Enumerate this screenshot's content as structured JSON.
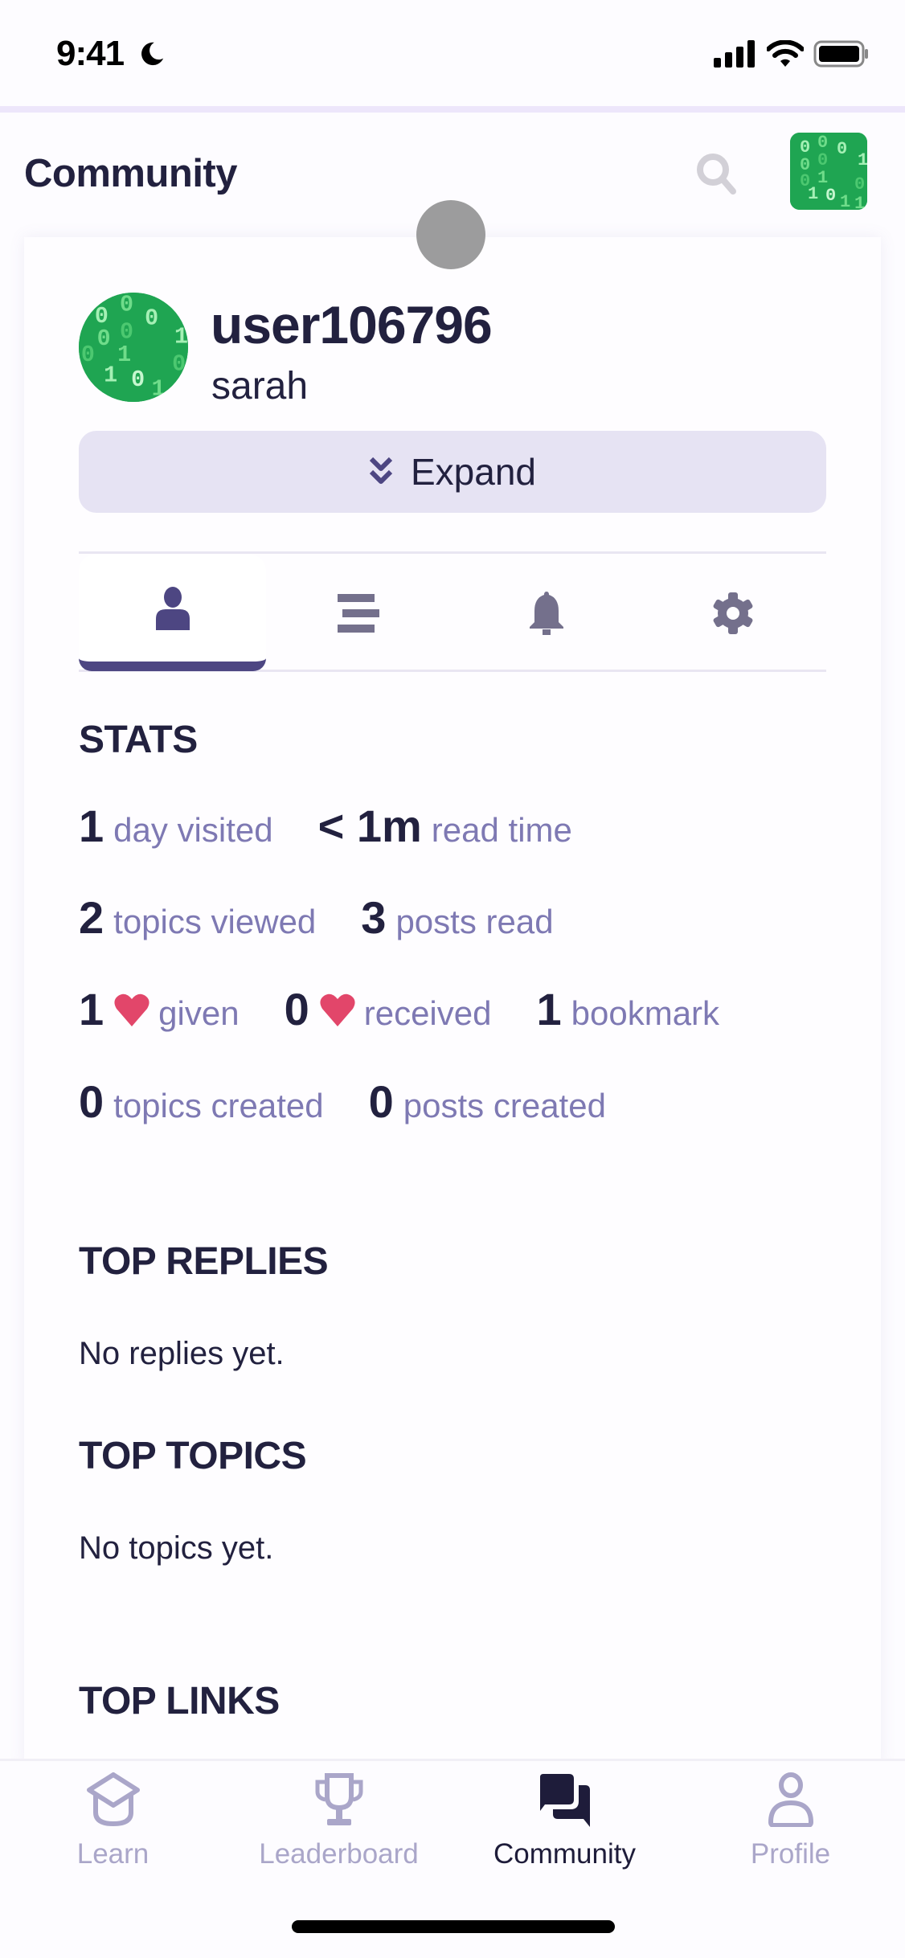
{
  "status_bar": {
    "time": "9:41",
    "icons": [
      "moon-icon",
      "signal-icon",
      "wifi-icon",
      "battery-icon"
    ]
  },
  "header": {
    "title": "Community",
    "search_icon": "search-icon",
    "avatar": "binary-code-avatar"
  },
  "profile": {
    "username": "user106796",
    "display_name": "sarah",
    "avatar": "binary-code-avatar",
    "expand_label": "Expand",
    "expand_icon": "double-chevron-down-icon"
  },
  "tabs": [
    {
      "name": "summary",
      "icon": "user-icon",
      "active": true
    },
    {
      "name": "activity",
      "icon": "stream-icon",
      "active": false
    },
    {
      "name": "notifications",
      "icon": "bell-icon",
      "active": false
    },
    {
      "name": "preferences",
      "icon": "gear-icon",
      "active": false
    }
  ],
  "stats": {
    "title": "STATS",
    "rows": [
      [
        {
          "value": "1",
          "label": "day visited"
        },
        {
          "value": "< 1m",
          "label": "read time"
        }
      ],
      [
        {
          "value": "2",
          "label": "topics viewed"
        },
        {
          "value": "3",
          "label": "posts read"
        }
      ],
      [
        {
          "value": "1",
          "label": "given",
          "icon": "heart-icon"
        },
        {
          "value": "0",
          "label": "received",
          "icon": "heart-icon"
        },
        {
          "value": "1",
          "label": "bookmark"
        }
      ],
      [
        {
          "value": "0",
          "label": "topics created"
        },
        {
          "value": "0",
          "label": "posts created"
        }
      ]
    ]
  },
  "sections": [
    {
      "title": "TOP REPLIES",
      "empty": "No replies yet."
    },
    {
      "title": "TOP TOPICS",
      "empty": "No topics yet."
    },
    {
      "title": "TOP LINKS",
      "empty": ""
    }
  ],
  "bottom_nav": [
    {
      "label": "Learn",
      "icon": "graduation-cap-icon",
      "active": false
    },
    {
      "label": "Leaderboard",
      "icon": "trophy-icon",
      "active": false
    },
    {
      "label": "Community",
      "icon": "chat-bubbles-icon",
      "active": true
    },
    {
      "label": "Profile",
      "icon": "person-icon",
      "active": false
    }
  ],
  "colors": {
    "primary_text": "#22213f",
    "accent": "#4d4682",
    "stat_label": "#7e79b3",
    "heart": "#e2466a",
    "expand_bg": "#e6e3f3",
    "nav_inactive": "#aaa6c9",
    "avatar_green": "#1fa552"
  }
}
